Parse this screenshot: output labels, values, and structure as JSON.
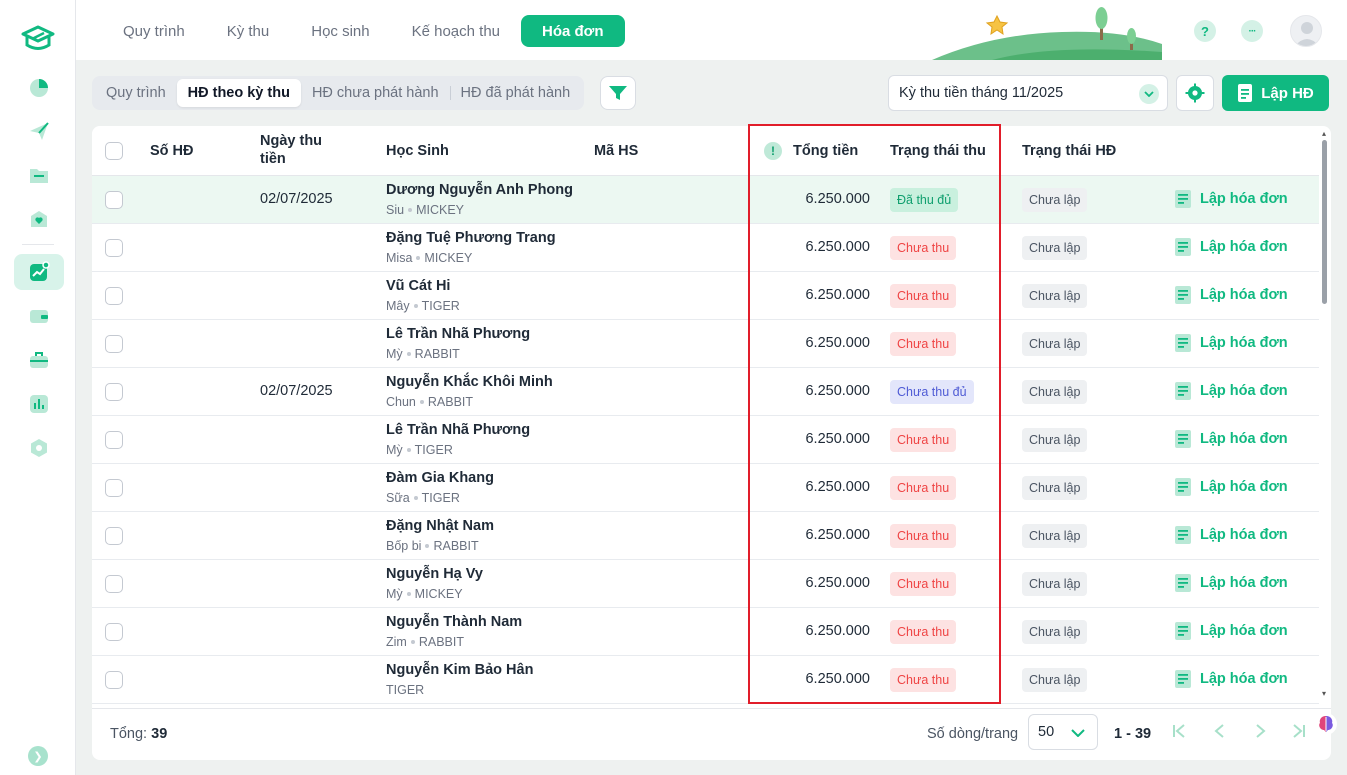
{
  "topnav": {
    "tabs": [
      {
        "label": "Quy trình",
        "active": false
      },
      {
        "label": "Kỳ thu",
        "active": false
      },
      {
        "label": "Học sinh",
        "active": false
      },
      {
        "label": "Kế hoạch thu",
        "active": false
      },
      {
        "label": "Hóa đơn",
        "active": true
      }
    ],
    "help_icon": "?",
    "more_icon": "···"
  },
  "subtabs": [
    {
      "label": "Quy trình",
      "active": false
    },
    {
      "label": "HĐ theo kỳ thu",
      "active": true
    },
    {
      "label": "HĐ chưa phát hành",
      "active": false
    },
    {
      "label": "HĐ đã phát hành",
      "active": false
    }
  ],
  "toolbar": {
    "period": "Kỳ thu tiền tháng 11/2025",
    "create_label": "Lập HĐ"
  },
  "table": {
    "headers": {
      "invoice_no": "Số HĐ",
      "date_line1": "Ngày thu",
      "date_line2": "tiền",
      "student": "Học Sinh",
      "student_code": "Mã HS",
      "warn": "!",
      "total": "Tổng tiền",
      "pay_status": "Trạng thái thu",
      "invoice_status": "Trạng thái HĐ"
    },
    "action_label": "Lập hóa đơn",
    "rows": [
      {
        "date": "02/07/2025",
        "name": "Dương Nguyễn Anh Phong",
        "nick": "Siu",
        "cls": "MICKEY",
        "amount": "6.250.000",
        "pay": "Đã thu đủ",
        "pay_kind": "paid",
        "inv": "Chưa lập"
      },
      {
        "date": "",
        "name": "Đặng Tuệ Phương Trang",
        "nick": "Misa",
        "cls": "MICKEY",
        "amount": "6.250.000",
        "pay": "Chưa thu",
        "pay_kind": "unpaid",
        "inv": "Chưa lập"
      },
      {
        "date": "",
        "name": "Vũ Cát Hi",
        "nick": "Mây",
        "cls": "TIGER",
        "amount": "6.250.000",
        "pay": "Chưa thu",
        "pay_kind": "unpaid",
        "inv": "Chưa lập"
      },
      {
        "date": "",
        "name": "Lê Trần Nhã Phương",
        "nick": "Mỳ",
        "cls": "RABBIT",
        "amount": "6.250.000",
        "pay": "Chưa thu",
        "pay_kind": "unpaid",
        "inv": "Chưa lập"
      },
      {
        "date": "02/07/2025",
        "name": "Nguyễn Khắc Khôi Minh",
        "nick": "Chun",
        "cls": "RABBIT",
        "amount": "6.250.000",
        "pay": "Chưa thu đủ",
        "pay_kind": "partial",
        "inv": "Chưa lập"
      },
      {
        "date": "",
        "name": "Lê Trần Nhã Phương",
        "nick": "Mỳ",
        "cls": "TIGER",
        "amount": "6.250.000",
        "pay": "Chưa thu",
        "pay_kind": "unpaid",
        "inv": "Chưa lập"
      },
      {
        "date": "",
        "name": "Đàm Gia Khang",
        "nick": "Sữa",
        "cls": "TIGER",
        "amount": "6.250.000",
        "pay": "Chưa thu",
        "pay_kind": "unpaid",
        "inv": "Chưa lập"
      },
      {
        "date": "",
        "name": "Đặng Nhật Nam",
        "nick": "Bốp bi",
        "cls": "RABBIT",
        "amount": "6.250.000",
        "pay": "Chưa thu",
        "pay_kind": "unpaid",
        "inv": "Chưa lập"
      },
      {
        "date": "",
        "name": "Nguyễn Hạ Vy",
        "nick": "Mỳ",
        "cls": "MICKEY",
        "amount": "6.250.000",
        "pay": "Chưa thu",
        "pay_kind": "unpaid",
        "inv": "Chưa lập"
      },
      {
        "date": "",
        "name": "Nguyễn Thành Nam",
        "nick": "Zim",
        "cls": "RABBIT",
        "amount": "6.250.000",
        "pay": "Chưa thu",
        "pay_kind": "unpaid",
        "inv": "Chưa lập"
      },
      {
        "date": "",
        "name": "Nguyễn Kim Bảo Hân",
        "nick": "",
        "cls": "TIGER",
        "amount": "6.250.000",
        "pay": "Chưa thu",
        "pay_kind": "unpaid",
        "inv": "Chưa lập"
      }
    ]
  },
  "footer": {
    "total_label": "Tổng:",
    "total_value": "39",
    "rows_per_page_label": "Số dòng/trang",
    "rows_per_page": "50",
    "range": "1 - 39"
  },
  "colors": {
    "brand": "#10b981",
    "highlight_border": "#e11d2a"
  }
}
